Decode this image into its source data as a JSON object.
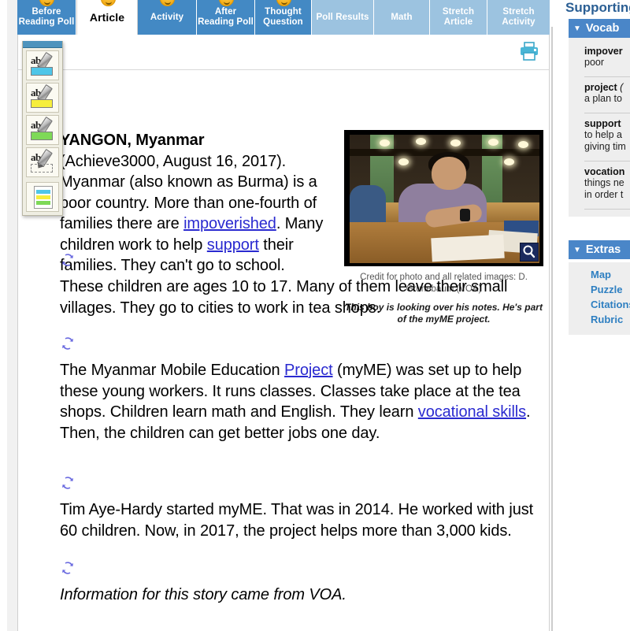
{
  "tabs": [
    {
      "label": "Before Reading Poll",
      "state": "normal",
      "badge": true
    },
    {
      "label": "Article",
      "state": "active",
      "badge": true
    },
    {
      "label": "Activity",
      "state": "normal",
      "badge": true
    },
    {
      "label": "After Reading Poll",
      "state": "normal",
      "badge": true
    },
    {
      "label": "Thought Question",
      "state": "normal",
      "badge": true
    },
    {
      "label": "Poll Results",
      "state": "light",
      "badge": false
    },
    {
      "label": "Math",
      "state": "light",
      "badge": false
    },
    {
      "label": "Stretch Article",
      "state": "light",
      "badge": false
    },
    {
      "label": "Stretch Activity",
      "state": "light",
      "badge": false
    }
  ],
  "toolbar": {
    "print_icon": "printer-icon",
    "highlighters": [
      {
        "name": "blue-highlighter",
        "color": "#4fc6e8",
        "letters": "ab"
      },
      {
        "name": "yellow-highlighter",
        "color": "#f6ee3c",
        "letters": "ab"
      },
      {
        "name": "green-highlighter",
        "color": "#7ed957",
        "letters": "ab"
      },
      {
        "name": "clear-highlighter",
        "color": "transparent",
        "letters": "ab"
      }
    ],
    "show_highlights": {
      "name": "show-all-highlights",
      "stripes": [
        "#4fc6e8",
        "#f6ee3c",
        "#7ed957"
      ]
    }
  },
  "article": {
    "dateline": "YANGON, Myanmar",
    "lede_parts": [
      {
        "t": "(Achieve3000, August 16, 2017). Myanmar (also known as Burma) is a poor country. More than one-fourth of families there are ",
        "link": false
      },
      {
        "t": "impoverished",
        "link": true
      },
      {
        "t": ". Many children work to help ",
        "link": false
      },
      {
        "t": "support",
        "link": true
      },
      {
        "t": " their families. They can't go to school.",
        "link": false
      }
    ],
    "paragraphs": [
      {
        "parts": [
          {
            "t": "These children are ages 10 to 17. Many of them leave their small villages. They go to cities to work in tea shops.",
            "link": false
          }
        ],
        "italic": false
      },
      {
        "parts": [
          {
            "t": "The Myanmar Mobile Education ",
            "link": false
          },
          {
            "t": "Project",
            "link": true
          },
          {
            "t": " (myME) was set up to help these young workers. It runs classes. Classes take place at the tea shops. Children learn math and English. They learn ",
            "link": false
          },
          {
            "t": "vocational skills",
            "link": true
          },
          {
            "t": ". Then, the children can get better jobs one day.",
            "link": false
          }
        ],
        "italic": false
      },
      {
        "parts": [
          {
            "t": "Tim Aye-Hardy started myME. That was in 2014. He worked with just 60 children. Now, in 2017, the project helps more than 3,000 kids.",
            "link": false
          }
        ],
        "italic": false
      },
      {
        "parts": [
          {
            "t": "Information for this story came from VOA.",
            "link": false
          }
        ],
        "italic": true
      }
    ],
    "reword_icon": "reword-icon"
  },
  "photo": {
    "zoom_icon": "magnifier-icon",
    "credit": "Credit for photo and all related images: D. Grunebaum (VOA)",
    "caption": "This boy is looking over his notes. He's part of the myME project."
  },
  "sidebar": {
    "title": "Supporting",
    "vocab_header": "Vocab",
    "extras_header": "Extras",
    "caret": "▼",
    "vocab": [
      {
        "word": "impover",
        "word_italic": "",
        "definition": "poor"
      },
      {
        "word": "project ",
        "word_italic": "(",
        "definition": "a plan to"
      },
      {
        "word": "support",
        "word_italic": "",
        "definition": "to help a\ngiving tim"
      },
      {
        "word": "vocation",
        "word_italic": "",
        "definition": "things ne\nin order t"
      }
    ],
    "extras": [
      "Map",
      "Puzzle",
      "Citations",
      "Rubric"
    ]
  },
  "colors": {
    "tab_blue": "#4389c4",
    "tab_light_blue": "#9cc3e0",
    "sidebar_header": "#4a86c8",
    "link": "#2a2ad0",
    "sidebar_link": "#2e7fc1",
    "badge": "#f5b61a"
  }
}
